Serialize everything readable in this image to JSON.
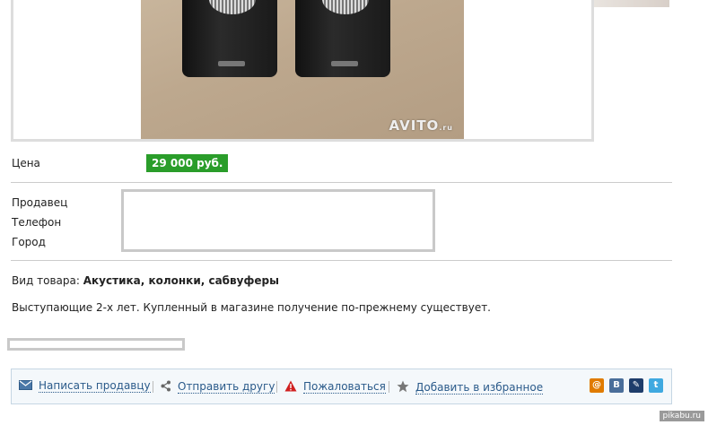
{
  "photo": {
    "watermark": "AVITO",
    "watermark_suffix": ".ru"
  },
  "price": {
    "label": "Цена",
    "value": "29 000 руб.",
    "color": "#2a9d2a"
  },
  "seller": {
    "label_seller": "Продавец",
    "label_phone": "Телефон",
    "label_city": "Город"
  },
  "category": {
    "label": "Вид товара:",
    "value": "Акустика, колонки, сабвуферы"
  },
  "description": "Выступающие 2-х лет. Купленный в магазине получение по-прежнему существует.",
  "actions": [
    {
      "label": "Написать продавцу",
      "icon": "mail-icon"
    },
    {
      "label": "Отправить другу",
      "icon": "share-icon"
    },
    {
      "label": "Пожаловаться",
      "icon": "warning-icon"
    },
    {
      "label": "Добавить в избранное",
      "icon": "star-icon"
    }
  ],
  "social": [
    {
      "name": "mail-ru",
      "glyph": "@",
      "color": "#e07b00"
    },
    {
      "name": "vkontakte",
      "glyph": "B",
      "color": "#4a6e9a"
    },
    {
      "name": "livejournal",
      "glyph": "✎",
      "color": "#1e3d6b"
    },
    {
      "name": "twitter",
      "glyph": "t",
      "color": "#3fa9e0"
    }
  ],
  "footer": "pikabu.ru"
}
